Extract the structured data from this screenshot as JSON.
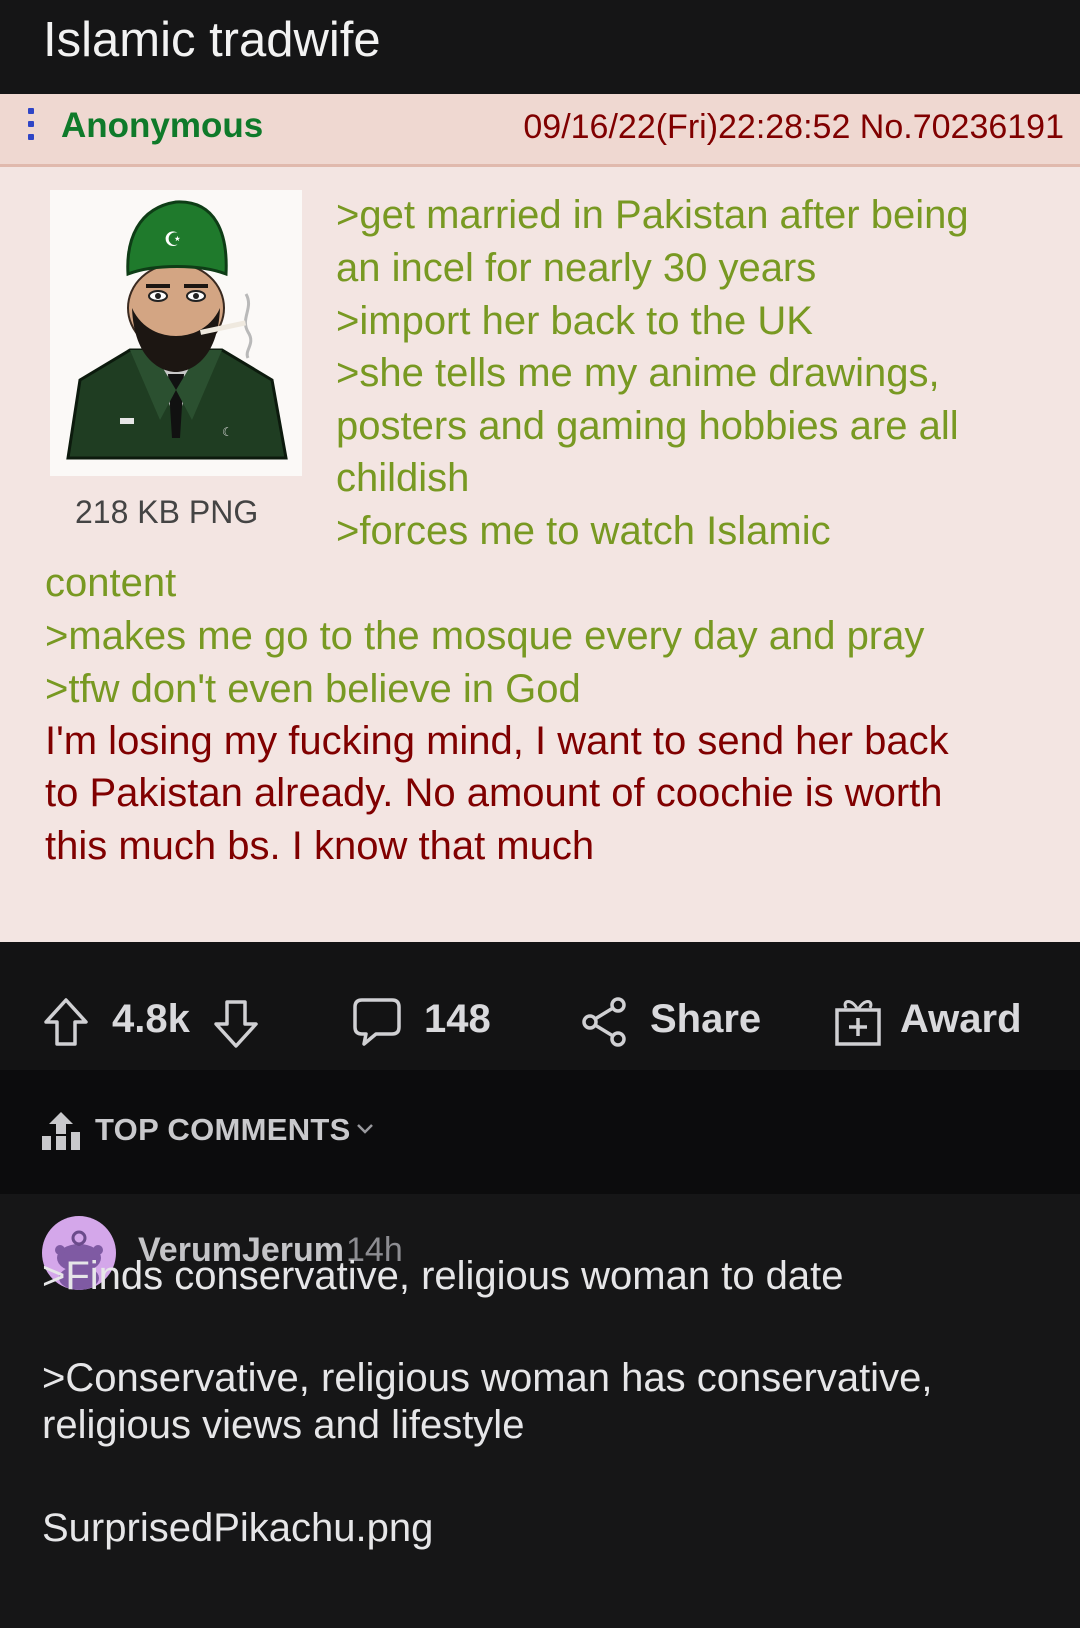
{
  "post": {
    "title": "Islamic tradwife"
  },
  "chan_post": {
    "name": "Anonymous",
    "datetime_no": "09/16/22(Fri)22:28:52 No.70236191",
    "file_info": "218 KB PNG",
    "lines": [
      ">get married in Pakistan after being",
      "an incel for nearly 30 years",
      ">import her back to the UK",
      ">she tells me my anime drawings,",
      "posters and gaming hobbies are all",
      "childish",
      ">forces me to watch Islamic",
      "content",
      ">makes me go to the mosque every day and pray",
      ">tfw don't even believe in God",
      "I'm losing my fucking mind, I want to send her back",
      "to Pakistan already. No amount of coochie is worth",
      "this much bs. I know that much"
    ]
  },
  "actions": {
    "votes": "4.8k",
    "comments": "148",
    "share": "Share",
    "award": "Award"
  },
  "comments_sort": {
    "label": "TOP COMMENTS"
  },
  "comment": {
    "username": "VerumJerum",
    "time": "14h",
    "lines": [
      ">Finds conservative, religious woman to date",
      ">Conservative, religious woman has conservative,",
      "religious views and lifestyle",
      "SurprisedPikachu.png"
    ]
  },
  "colors": {
    "greentext": "#789922",
    "quote_red": "#800000",
    "name_green": "#0f7a2a",
    "chan_bg": "#f3e5e2",
    "dark_bg": "#111112"
  },
  "icons": [
    "dots-icon",
    "upvote-icon",
    "downvote-icon",
    "comment-icon",
    "share-icon",
    "award-icon",
    "top-comments-icon",
    "chevron-down-icon",
    "snoo-avatar-icon"
  ]
}
